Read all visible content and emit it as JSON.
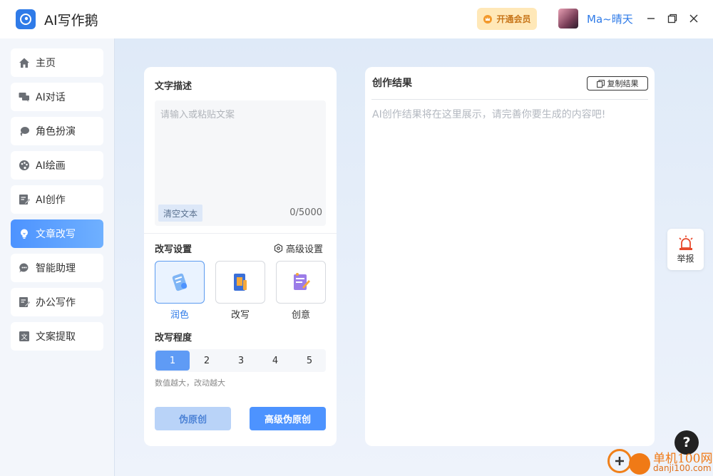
{
  "app": {
    "title": "AI写作鹅",
    "vip_label": "开通会员",
    "username": "Ma~晴天"
  },
  "sidebar": {
    "items": [
      {
        "label": "主页",
        "icon": "home-icon"
      },
      {
        "label": "AI对话",
        "icon": "chat-icon"
      },
      {
        "label": "角色扮演",
        "icon": "role-icon"
      },
      {
        "label": "AI绘画",
        "icon": "palette-icon"
      },
      {
        "label": "AI创作",
        "icon": "edit-doc-icon"
      },
      {
        "label": "文章改写",
        "icon": "lightbulb-icon",
        "active": true
      },
      {
        "label": "智能助理",
        "icon": "assistant-icon"
      },
      {
        "label": "办公写作",
        "icon": "office-icon"
      },
      {
        "label": "文案提取",
        "icon": "extract-icon"
      }
    ]
  },
  "input": {
    "section_label": "文字描述",
    "placeholder": "请输入或粘贴文案",
    "clear_label": "清空文本",
    "counter": "0/5000"
  },
  "rewrite": {
    "settings_label": "改写设置",
    "advanced_label": "高级设置",
    "modes": [
      {
        "label": "润色",
        "selected": true
      },
      {
        "label": "改写"
      },
      {
        "label": "创意"
      }
    ],
    "degree_label": "改写程度",
    "degrees": [
      "1",
      "2",
      "3",
      "4",
      "5"
    ],
    "selected_degree": "1",
    "hint": "数值越大，改动越大",
    "pseudo_btn": "伪原创",
    "advanced_btn": "高级伪原创"
  },
  "result": {
    "title": "创作结果",
    "copy_label": "复制结果",
    "placeholder": "AI创作结果将在这里展示，请完善你要生成的内容吧!"
  },
  "float": {
    "report_label": "举报",
    "help_label": "?"
  },
  "watermark": {
    "top": "单机100网",
    "bottom": "danji100.com"
  },
  "colors": {
    "accent": "#4d93ff",
    "vip_bg": "#ffe8b8",
    "vip_text": "#c8761a"
  }
}
